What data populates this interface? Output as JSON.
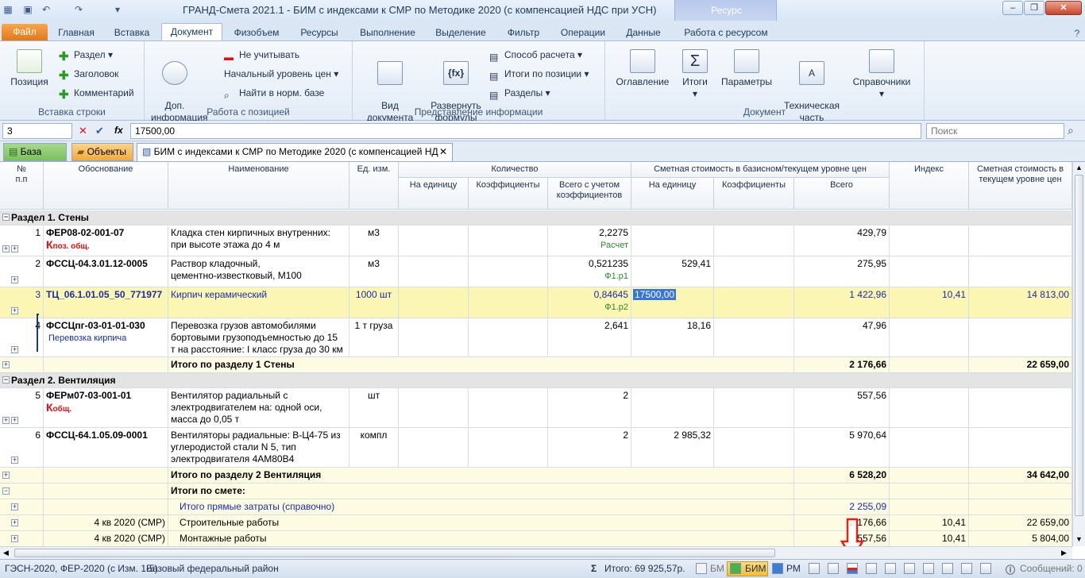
{
  "app": {
    "title": "ГРАНД-Смета 2021.1 - БИМ с индексами к СМР по Методике 2020 (с компенсацией НДС при УСН)",
    "context_tab": "Ресурс"
  },
  "tabs": [
    "Файл",
    "Главная",
    "Вставка",
    "Документ",
    "Физобъем",
    "Ресурсы",
    "Выполнение",
    "Выделение",
    "Фильтр",
    "Операции",
    "Данные",
    "Работа с ресурсом"
  ],
  "ribbon": {
    "insert_group": {
      "label": "Вставка строки",
      "position": "Позиция",
      "section": "Раздел",
      "heading": "Заголовок",
      "comment": "Комментарий"
    },
    "position_group": {
      "label": "Работа с позицией",
      "extra_info": "Доп.\nинформация",
      "ignore": "Не учитывать",
      "price_level": "Начальный уровень цен",
      "find": "Найти в норм. базе"
    },
    "view_group": {
      "label": "Представление информации",
      "view": "Вид\nдокумента",
      "expand": "Развернуть\nформулы",
      "calc_method": "Способ расчета",
      "totals": "Итоги по позиции",
      "sections": "Разделы"
    },
    "doc_group": {
      "label": "Документ",
      "toc": "Оглавление",
      "totals": "Итоги",
      "params": "Параметры",
      "tech": "Техническая\nчасть",
      "refs": "Справочники"
    }
  },
  "formula_bar": {
    "cell": "3",
    "fx": "fx",
    "value": "17500,00",
    "search_placeholder": "Поиск"
  },
  "doc_tabs": {
    "base": "База",
    "objects": "Объекты",
    "document": "БИМ с индексами к СМР по Методике 2020 (с компенсацией НД"
  },
  "headers": {
    "num": "№\nп.п",
    "basis": "Обоснование",
    "name": "Наименование",
    "unit": "Ед. изм.",
    "qty": "Количество",
    "qty_unit": "На единицу",
    "qty_coef": "Коэффициенты",
    "qty_total": "Всего с учетом\nкоэффициентов",
    "cost": "Сметная стоимость в базисном/текущем уровне цен",
    "cost_unit": "На единицу",
    "cost_coef": "Коэффициенты",
    "cost_total": "Всего",
    "index": "Индекс",
    "current": "Сметная стоимость в\nтекущем уровне цен"
  },
  "rows": {
    "s1": "Раздел 1. Стены",
    "r1": {
      "n": "1",
      "basis": "ФЕР08-02-001-07",
      "k": "К",
      "ksub": "поз. общ.",
      "name": "Кладка стен кирпичных внутренних:\nпри высоте этажа до 4 м",
      "unit": "м3",
      "qty": "2,2275",
      "qty_note": "Расчет",
      "total": "429,79"
    },
    "r2": {
      "n": "2",
      "basis": "ФССЦ-04.3.01.12-0005",
      "name": "Раствор кладочный,\nцементно-известковый, М100",
      "unit": "м3",
      "qty": "0,521235",
      "qty_note": "Ф1.р1",
      "cost_unit": "529,41",
      "total": "275,95"
    },
    "r3": {
      "n": "3",
      "basis": "ТЦ_06.1.01.05_50_771977",
      "name": "Кирпич керамический",
      "unit": "1000 шт",
      "qty": "0,84645",
      "qty_note": "Ф1.р2",
      "cost_unit": "17500,00",
      "total": "1 422,96",
      "index": "10,41",
      "current": "14 813,00"
    },
    "r4": {
      "n": "4",
      "basis": "ФССЦпг-03-01-01-030",
      "sub": "Перевозка кирпича",
      "name": "Перевозка грузов автомобилями\nбортовыми грузоподъемностью до 15\nт на расстояние: I класс груза до 30 км",
      "unit": "1 т груза",
      "qty": "2,641",
      "cost_unit": "18,16",
      "total": "47,96"
    },
    "t1": {
      "name": "Итого по разделу 1 Стены",
      "total": "2 176,66",
      "current": "22 659,00"
    },
    "s2": "Раздел 2. Вентиляция",
    "r5": {
      "n": "5",
      "basis": "ФЕРм07-03-001-01",
      "k": "К",
      "ksub": "общ.",
      "name": "Вентилятор радиальный с\nэлектродвигателем на: одной оси,\nмасса до 0,05 т",
      "unit": "шт",
      "qty": "2",
      "total": "557,56"
    },
    "r6": {
      "n": "6",
      "basis": "ФССЦ-64.1.05.09-0001",
      "name": "Вентиляторы радиальные: В-Ц4-75 из\nуглеродистой стали N 5, тип\nэлектродвигателя 4АМ80В4",
      "unit": "компл",
      "qty": "2",
      "cost_unit": "2 985,32",
      "total": "5 970,64"
    },
    "t2": {
      "name": "Итого по разделу 2 Вентиляция",
      "total": "6 528,20",
      "current": "34 642,00"
    },
    "tt": {
      "name": "Итоги по смете:"
    },
    "tp": {
      "name": "Итого прямые затраты (справочно)",
      "total": "2 255,09"
    },
    "tc": {
      "basis": "4 кв 2020 (СМР)",
      "name": "Строительные работы",
      "total": "2 176,66",
      "index": "10,41",
      "current": "22 659,00"
    },
    "tm": {
      "basis": "4 кв 2020 (СМР)",
      "name": "Монтажные работы",
      "total": "557,56",
      "index": "10,41",
      "current": "5 804,00"
    }
  },
  "status": {
    "base": "ГЭСН-2020, ФЕР-2020 (с Изм. 1-5)",
    "region": "Базовый федеральный район",
    "total": "Итого: 69 925,57р.",
    "bm": "БМ",
    "bim": "БИМ",
    "rm": "РМ",
    "messages": "Сообщений: 0"
  },
  "colors": {
    "accent": "#e2761c",
    "selected_row": "#fbf6b4",
    "total_row": "#fdfbe2",
    "section_row": "#e4e4e4",
    "arrow": "#e0221a"
  }
}
